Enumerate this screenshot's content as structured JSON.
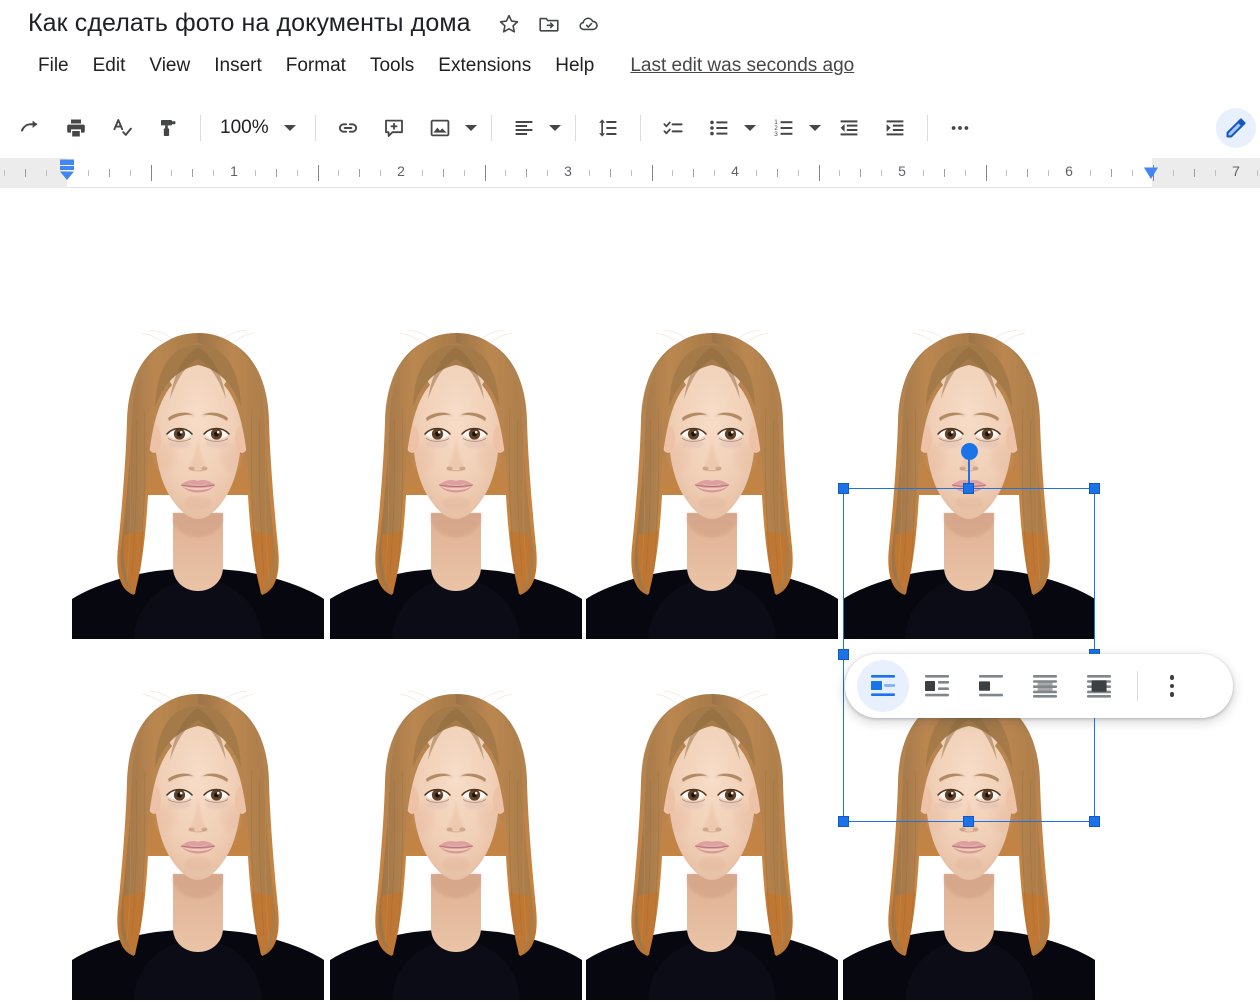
{
  "app": {
    "name": "Google Docs"
  },
  "titlebar": {
    "doc_title": "Как сделать фото на документы дома",
    "icons": [
      {
        "name": "star-icon",
        "label": "Star"
      },
      {
        "name": "move-to-folder-icon",
        "label": "Move"
      },
      {
        "name": "cloud-saved-icon",
        "label": "Saved to Drive"
      }
    ]
  },
  "menubar": {
    "items": [
      {
        "label": "File"
      },
      {
        "label": "Edit"
      },
      {
        "label": "View"
      },
      {
        "label": "Insert"
      },
      {
        "label": "Format"
      },
      {
        "label": "Tools"
      },
      {
        "label": "Extensions"
      },
      {
        "label": "Help"
      }
    ],
    "last_edit": "Last edit was seconds ago"
  },
  "toolbar": {
    "zoom_value": "100%",
    "buttons": [
      {
        "name": "redo-button",
        "label": "Redo"
      },
      {
        "name": "print-button",
        "label": "Print"
      },
      {
        "name": "spelling-check-button",
        "label": "Spelling and grammar check"
      },
      {
        "name": "paint-format-button",
        "label": "Paint format"
      },
      {
        "name": "insert-link-button",
        "label": "Insert link"
      },
      {
        "name": "add-comment-button",
        "label": "Add comment"
      },
      {
        "name": "insert-image-button",
        "label": "Insert image"
      },
      {
        "name": "align-button",
        "label": "Align"
      },
      {
        "name": "line-spacing-button",
        "label": "Line & paragraph spacing"
      },
      {
        "name": "checklist-button",
        "label": "Checklist"
      },
      {
        "name": "bulleted-list-button",
        "label": "Bulleted list"
      },
      {
        "name": "numbered-list-button",
        "label": "Numbered list"
      },
      {
        "name": "decrease-indent-button",
        "label": "Decrease indent"
      },
      {
        "name": "increase-indent-button",
        "label": "Increase indent"
      },
      {
        "name": "more-options-button",
        "label": "More"
      }
    ],
    "edit_mode": {
      "name": "editing-mode-button",
      "label": "Editing mode"
    }
  },
  "ruler": {
    "numbers": [
      "1",
      "2",
      "3",
      "4",
      "5",
      "6",
      "7"
    ],
    "left_indent_label": "Left indent",
    "right_indent_label": "Right indent"
  },
  "image_toolbar": {
    "options": [
      {
        "name": "wrap-inline-button",
        "label": "In line",
        "selected": true
      },
      {
        "name": "wrap-text-button",
        "label": "Wrap text",
        "selected": false
      },
      {
        "name": "break-text-button",
        "label": "Break text",
        "selected": false
      },
      {
        "name": "behind-text-button",
        "label": "Behind text",
        "selected": false
      },
      {
        "name": "in-front-of-text-button",
        "label": "In front of text",
        "selected": false
      }
    ],
    "more_label": "All image options"
  },
  "document": {
    "photo_alt": "Passport-style portrait photo of a young woman with shoulder-length auburn hair wearing a black top on a white background",
    "photo_count": 8,
    "rows": 2,
    "columns": 4,
    "selected_photo_index": 4
  },
  "colors": {
    "accent": "#1a73e8",
    "selected_bg": "#e8f0fe",
    "icon": "#444746",
    "text": "#202124",
    "ruler_margin": "#ececed"
  }
}
